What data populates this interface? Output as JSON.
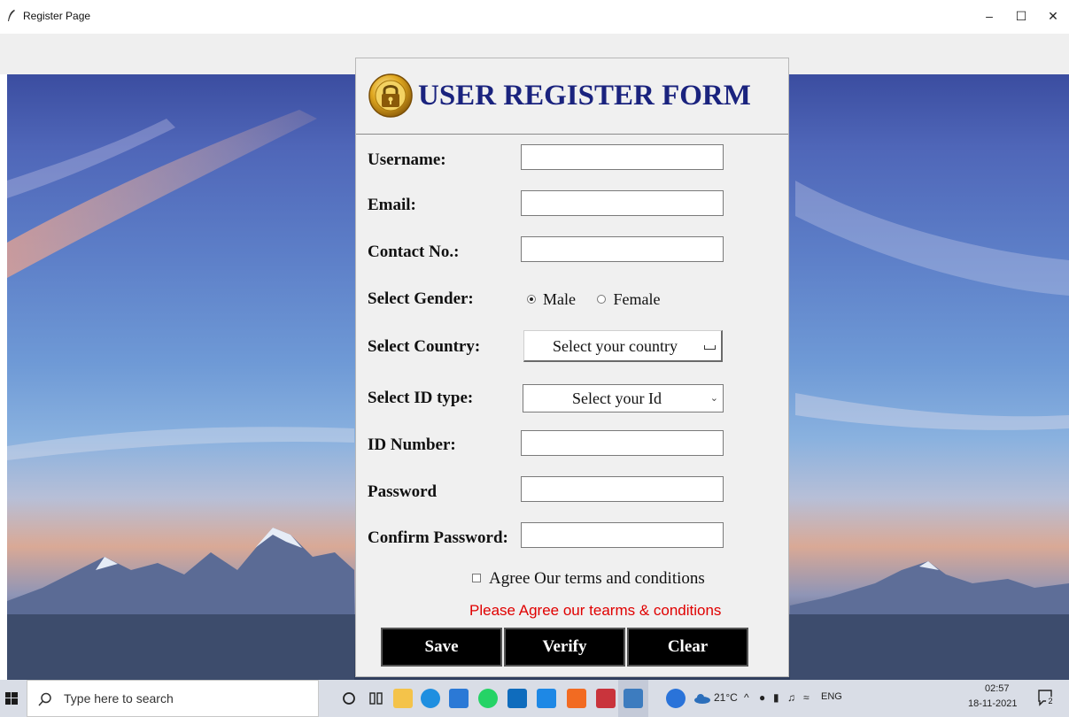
{
  "window": {
    "title": "Register Page",
    "minimize": "–",
    "maximize": "☐",
    "close": "✕"
  },
  "form": {
    "header_title": "USER REGISTER FORM",
    "labels": {
      "username": "Username:",
      "email": "Email:",
      "contact": "Contact No.:",
      "gender": "Select Gender:",
      "country": "Select Country:",
      "id_type": "Select ID type:",
      "id_number": "ID Number:",
      "password": "Password",
      "confirm_password": "Confirm Password:"
    },
    "values": {
      "username": "",
      "email": "",
      "contact": "",
      "id_number": "",
      "password": "",
      "confirm_password": ""
    },
    "gender_options": [
      "Male",
      "Female"
    ],
    "gender_selected": "Male",
    "country_selected": "Select your country",
    "id_type_selected": "Select your Id",
    "agree_text": "Agree Our terms and conditions",
    "warning_text": "Please Agree our tearms & conditions",
    "buttons": {
      "save": "Save",
      "verify": "Verify",
      "clear": "Clear"
    }
  },
  "taskbar": {
    "search_placeholder": "Type here to search",
    "weather": "21°C",
    "language": "ENG",
    "time": "02:57",
    "date": "18-11-2021",
    "notifications": "2"
  },
  "colors": {
    "title": "#1a237e",
    "warning": "#e00000",
    "button_bg": "#000000",
    "panel_bg": "#f0f0f0"
  }
}
